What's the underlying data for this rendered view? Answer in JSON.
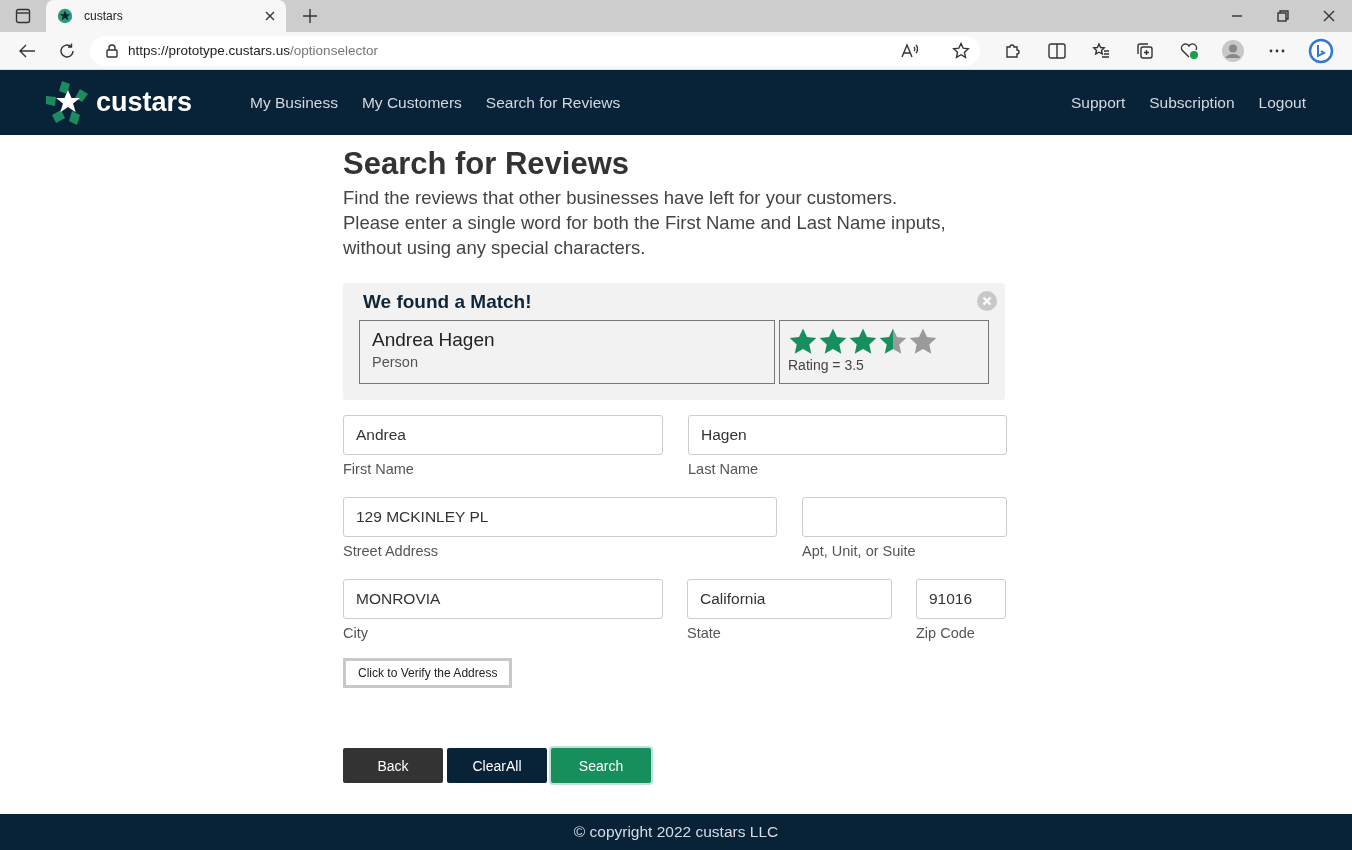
{
  "browser": {
    "tab_title": "custars",
    "url_host": "https://prototype.custars.us",
    "url_path": "/optionselector"
  },
  "nav": {
    "brand": "custars",
    "links": [
      {
        "label": "My Business"
      },
      {
        "label": "My Customers"
      },
      {
        "label": "Search for Reviews"
      }
    ],
    "right_links": [
      {
        "label": "Support"
      },
      {
        "label": "Subscription"
      },
      {
        "label": "Logout"
      }
    ]
  },
  "page": {
    "title": "Search for Reviews",
    "intro": "Find the reviews that other businesses have left for your customers.\nPlease enter a single word for both the First Name and Last Name inputs,\nwithout using any special characters."
  },
  "match": {
    "heading": "We found a Match!",
    "name": "Andrea Hagen",
    "type": "Person",
    "stars": 3.5,
    "rating": "Rating = 3.5"
  },
  "field_rows": [
    [
      {
        "label": "First Name",
        "value": "Andrea"
      },
      {
        "label": "Last Name",
        "value": "Hagen"
      }
    ],
    [
      {
        "label": "Street Address",
        "value": "129 MCKINLEY PL"
      },
      {
        "label": "Apt, Unit, or Suite"
      }
    ],
    [
      {
        "label": "City",
        "value": "MONROVIA"
      },
      {
        "label": "State",
        "value": "California"
      },
      {
        "label": "Zip Code",
        "value": "91016"
      }
    ]
  ],
  "verify_button": "Click to Verify the Address",
  "buttons": [
    {
      "label": "Back",
      "kind": "back"
    },
    {
      "label": "ClearAll",
      "kind": "clear"
    },
    {
      "label": "Search",
      "kind": "primary"
    }
  ],
  "footer": "© copyright 2022 custars LLC"
}
